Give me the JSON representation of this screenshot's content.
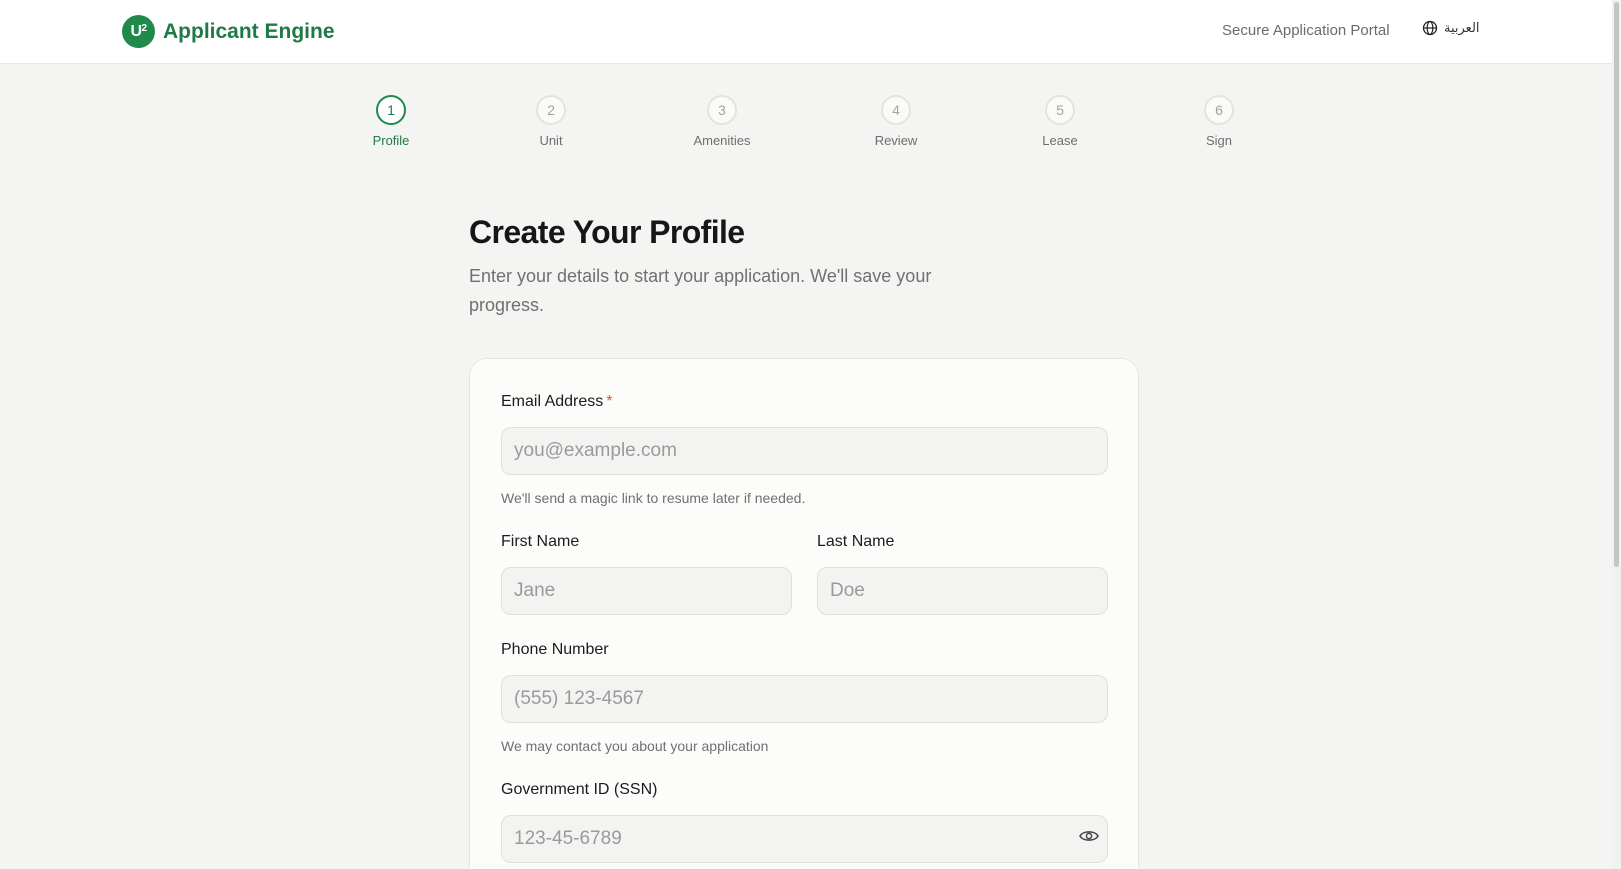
{
  "header": {
    "logo_badge": "U",
    "logo_badge_sup": "2",
    "app_name": "Applicant Engine",
    "portal_label": "Secure Application Portal",
    "language_label": "العربية",
    "language_icon": "globe-icon"
  },
  "stepper": {
    "steps": [
      {
        "number": "1",
        "label": "Profile",
        "active": true
      },
      {
        "number": "2",
        "label": "Unit",
        "active": false
      },
      {
        "number": "3",
        "label": "Amenities",
        "active": false
      },
      {
        "number": "4",
        "label": "Review",
        "active": false
      },
      {
        "number": "5",
        "label": "Lease",
        "active": false
      },
      {
        "number": "6",
        "label": "Sign",
        "active": false
      }
    ]
  },
  "main": {
    "title": "Create Your Profile",
    "subtitle": "Enter your details to start your application. We'll save your progress."
  },
  "form": {
    "email": {
      "label": "Email Address",
      "required_mark": "*",
      "placeholder": "you@example.com",
      "value": "",
      "help": "We'll send a magic link to resume later if needed."
    },
    "first_name": {
      "label": "First Name",
      "placeholder": "Jane",
      "value": ""
    },
    "last_name": {
      "label": "Last Name",
      "placeholder": "Doe",
      "value": ""
    },
    "phone": {
      "label": "Phone Number",
      "placeholder": "(555) 123-4567",
      "value": "",
      "help": "We may contact you about your application"
    },
    "ssn": {
      "label": "Government ID (SSN)",
      "placeholder": "123-45-6789",
      "value": "",
      "toggle_icon": "eye-icon"
    }
  },
  "colors": {
    "brand": "#1f8a4c",
    "brand_text": "#1f7a45",
    "required": "#d25b2a",
    "background": "#f4f4f2"
  }
}
